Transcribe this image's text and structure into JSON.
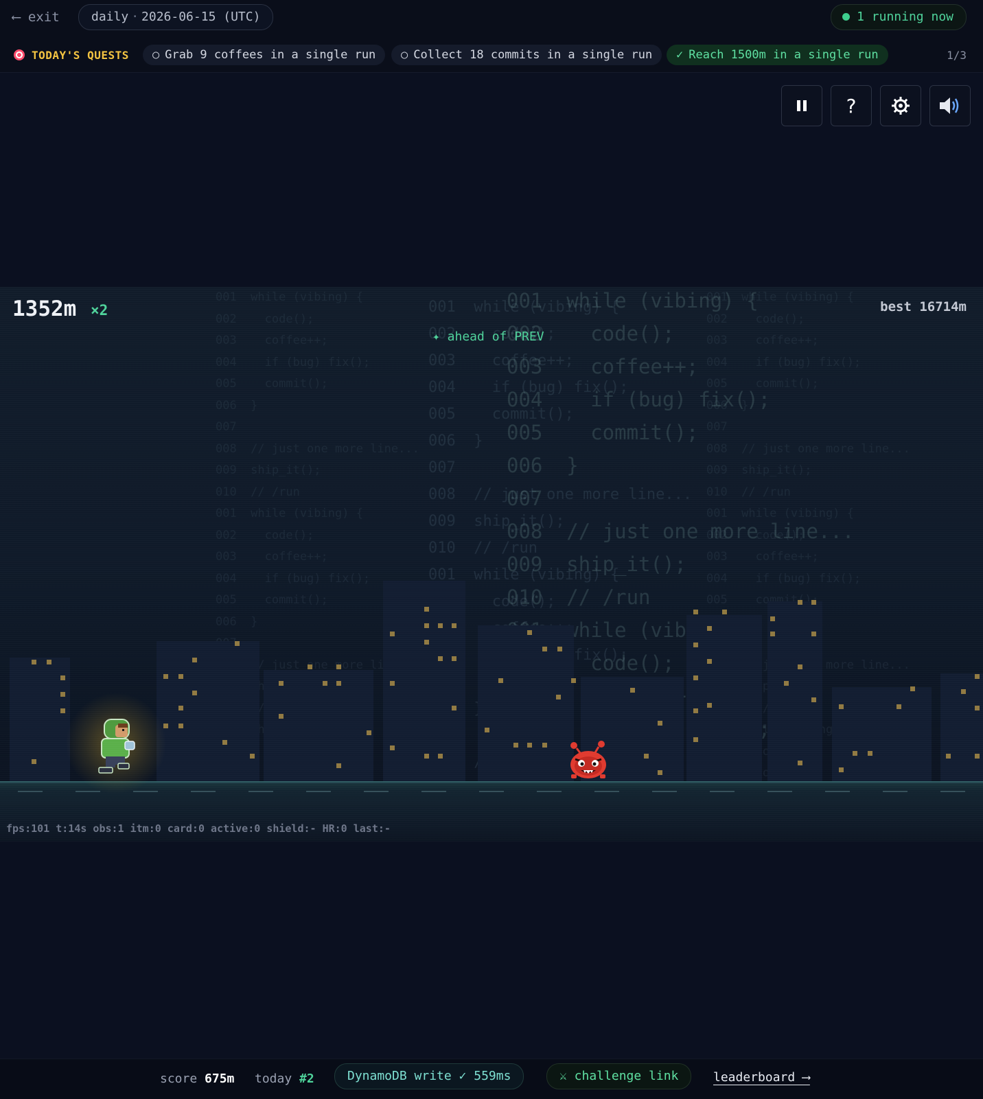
{
  "topbar": {
    "exit_label": "⟵ exit",
    "mode": "daily",
    "date": "2026-06-15 (UTC)",
    "running": "1 running now"
  },
  "quests": {
    "title": "TODAY'S QUESTS",
    "items": [
      {
        "mark": "○",
        "label": "Grab 9 coffees in a single run",
        "done": false
      },
      {
        "mark": "○",
        "label": "Collect 18 commits in a single run",
        "done": false
      },
      {
        "mark": "✓",
        "label": "Reach 1500m in a single run",
        "done": true
      }
    ],
    "progress": "1/3"
  },
  "controls": {
    "pause": "⏸",
    "help": "?",
    "settings": "⚙",
    "sound": "🔊"
  },
  "hud": {
    "distance": "1352m",
    "multiplier": "×2",
    "best": "best 16714m",
    "ahead": "✦ ahead of PREV",
    "debug": "fps:101 t:14s obs:1 itm:0 card:0 active:0 shield:- HR:0 last:-"
  },
  "background_code": {
    "small": "001  while (vibing) {\n002    code();\n003    coffee++;\n004    if (bug) fix();\n005    commit();\n006  }\n007\n008  // just one more line...\n009  ship_it();\n010  // /run\n001  while (vibing) {\n002    code();\n003    coffee++;\n004    if (bug) fix();\n005    commit();\n006  }\n007\n008  // just one more line...\n009  ship_it();\n010  // /run\n001  while (vibing) {\n002    code();\n003    coffee++;",
    "medium": "001  while (vibing) {\n002    code();\n003    coffee++;\n004    if (bug) fix();\n005    commit();\n006  }\n007\n008  // just one more line...\n009  ship_it();\n010  // /run\n001  while (vibing) {\n002    code();\n003    coffee++;\n004    if (bug) fix();\n005    commit();\n006  }\n007\n008  // just one more line...",
    "large": "001  while (vibing) {\n002    code();\n003    coffee++;\n004    if (bug) fix();\n005    commit();\n006  }\n007\n008  // just one more line...\n009  ship_it();\n010  // /run\n001  while (vibing) {\n002    code();\n003    coffee++;\n004    if (bug) fix();\n005    commit();"
  },
  "footer": {
    "score_label": "score",
    "score_value": "675m",
    "today_label": "today",
    "today_value": "#2",
    "db_status": "DynamoDB write ✓ 559ms",
    "challenge": "⚔ challenge link",
    "leaderboard": "leaderboard ⟶"
  },
  "colors": {
    "accent_green": "#4fd39b",
    "quest_title": "#f5c542",
    "background": "#0b1020",
    "enemy_red": "#e03a2f",
    "player_green": "#5bb04a"
  }
}
